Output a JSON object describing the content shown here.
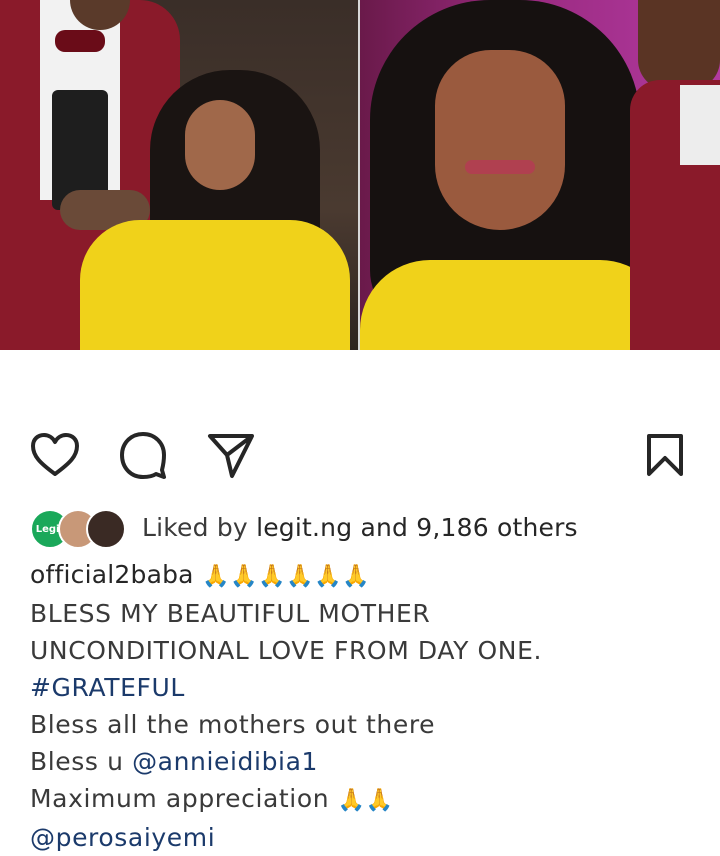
{
  "post": {
    "liked_by_prefix": "Liked by ",
    "liked_by_user": "legit.ng",
    "liked_by_suffix": " and ",
    "liked_by_count": "9,186 others",
    "avatar_label": "Legit",
    "caption": {
      "username": "official2baba",
      "emoji_row": "🙏🙏🙏🙏🙏🙏",
      "line1": "BLESS MY BEAUTIFUL MOTHER",
      "line2": "UNCONDITIONAL LOVE FROM DAY ONE.",
      "hashtag": "#GRATEFUL",
      "line4": "Bless all the mothers out there",
      "line5_prefix": "Bless u ",
      "mention1": "@annieidibia1",
      "line6_text": "Maximum appreciation ",
      "line6_emoji": "🙏🙏",
      "mention2": "@perosaiyemi"
    }
  },
  "icons": {
    "like": "heart-icon",
    "comment": "comment-bubble-icon",
    "share": "paper-plane-icon",
    "save": "bookmark-icon"
  }
}
